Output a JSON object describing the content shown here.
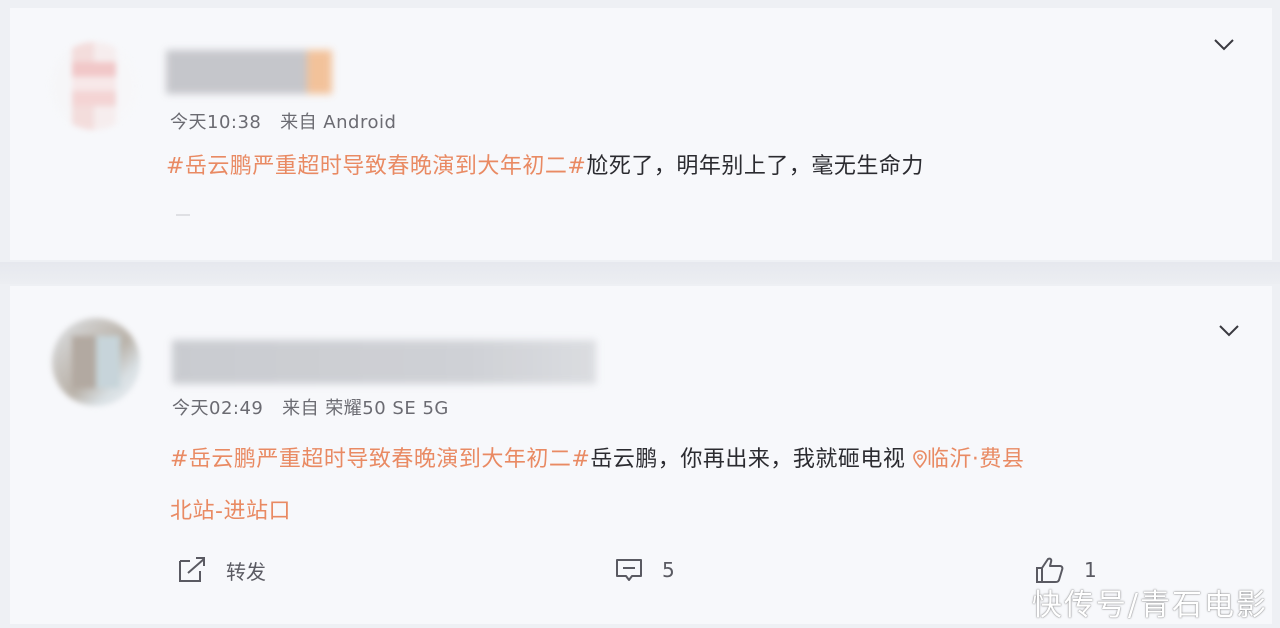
{
  "posts": [
    {
      "time": "今天10:38",
      "source": "来自 Android",
      "hashtag": "#岳云鹏严重超时导致春晚演到大年初二#",
      "text": "尬死了，明年别上了，毫无生命力"
    },
    {
      "time": "今天02:49",
      "source": "来自 荣耀50 SE 5G",
      "hashtag": "#岳云鹏严重超时导致春晚演到大年初二#",
      "text": "岳云鹏，你再出来，我就砸电视",
      "location_line1": "临沂·费县",
      "location_line2": "北站-进站口"
    }
  ],
  "actions": {
    "repost_label": "转发",
    "comment_count": "5",
    "like_count": "1"
  },
  "watermark": "快传号/青石电影",
  "colors": {
    "accent": "#e98a63",
    "text": "#2b2b30",
    "meta": "#6b6b72"
  }
}
